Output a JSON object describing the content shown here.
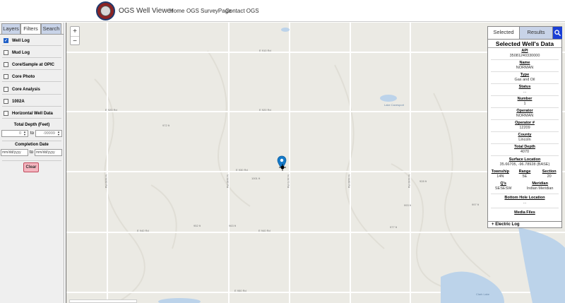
{
  "header": {
    "app_title": "OGS Well Viewer",
    "nav": [
      "Home",
      "OGS SurveyPage",
      "Contact OGS"
    ]
  },
  "left_panel": {
    "tabs": [
      "Layers",
      "Filters",
      "Search"
    ],
    "active_tab": "Filters",
    "checkboxes": [
      {
        "label": "Well Log",
        "checked": true
      },
      {
        "label": "Mud Log",
        "checked": false
      },
      {
        "label": "Core/Sample at OPIC",
        "checked": false
      },
      {
        "label": "Core Photo",
        "checked": false
      },
      {
        "label": "Core Analysis",
        "checked": false
      },
      {
        "label": "1002A",
        "checked": false
      },
      {
        "label": "Horizontal Well Data",
        "checked": false
      }
    ],
    "total_depth_label": "Total Depth (Feet)",
    "depth_min": "0",
    "depth_max": "-99999",
    "to_label": "to",
    "completion_date_label": "Completion Date",
    "date_placeholder": "mm/dd/yyyy",
    "clear_button": "Clear"
  },
  "map": {
    "zoom_in": "+",
    "zoom_out": "−",
    "labels": {
      "lake_cavesport": "Lake\nCavesport",
      "clark_lake": "Clark\nLake",
      "road_910": "E 910 Rd",
      "road_920": "E 920 Rd",
      "road_930": "E 930 Rd",
      "road_940": "E 940 Rd",
      "road_950": "E 950 Rd",
      "ns_3450": "N 3450 Rd",
      "ns_3460": "N 3460 Rd",
      "ns_3470": "N 3470 Rd",
      "ns_3480": "N 3480 Rd",
      "ns_3490": "N 3490 Rd",
      "elev_1": "972 ft",
      "elev_2": "1001 ft",
      "elev_3": "952 ft",
      "elev_4": "963 ft",
      "elev_5": "993 ft",
      "elev_6": "928 ft",
      "elev_7": "977 ft",
      "elev_8": "997 ft"
    }
  },
  "right_panel": {
    "tabs": [
      "Selected",
      "Results"
    ],
    "active_tab": "Selected",
    "title": "Selected Well's Data",
    "fields": [
      {
        "label": "API",
        "value": "35081240330000"
      },
      {
        "label": "Name",
        "value": "NORMAN"
      },
      {
        "label": "Type",
        "value": "Gas and Oil"
      },
      {
        "label": "Status",
        "value": "..."
      },
      {
        "label": "Number",
        "value": "1"
      },
      {
        "label": "Operator",
        "value": "NORMAN"
      },
      {
        "label": "Operator #",
        "value": "12209"
      },
      {
        "label": "County",
        "value": "Lincoln"
      },
      {
        "label": "Total Depth",
        "value": "4070"
      },
      {
        "label": "Surface Location",
        "value": "35.66705, -96.78928 (BASE)"
      }
    ],
    "township": {
      "label": "Township",
      "value": "14N"
    },
    "range": {
      "label": "Range",
      "value": "5E"
    },
    "section": {
      "label": "Section",
      "value": "20"
    },
    "qs": {
      "label": "Q's",
      "value": "SESESW"
    },
    "meridian": {
      "label": "Meridian",
      "value": "Indian Meridian"
    },
    "bottom_hole": {
      "label": "Bottom Hole Location",
      "value": "..."
    },
    "media_files": "Media Files",
    "electric_log": "Electric Log",
    "plus": "+"
  },
  "colors": {
    "accent": "#1a3fd6",
    "clear_bg": "#f4b5bf",
    "tab_bg": "#c8d3e8",
    "map_bg": "#ebeae4",
    "water": "#bcd3ea",
    "marker": "#1479c8"
  },
  "icons": [
    "search-icon",
    "map-pin-icon",
    "well-symbol-icon",
    "logo-icon"
  ]
}
